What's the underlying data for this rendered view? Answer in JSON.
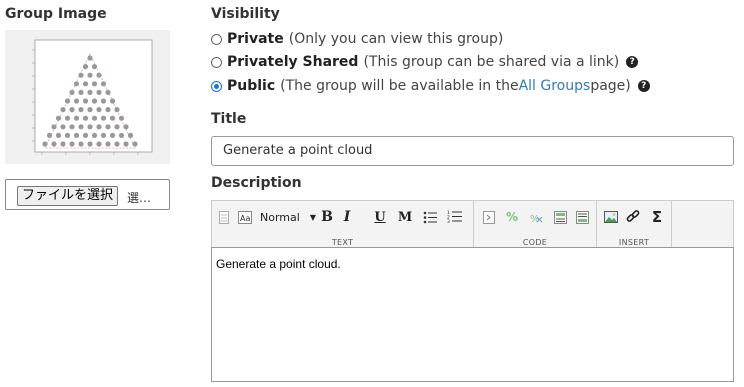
{
  "group_image": {
    "heading": "Group Image"
  },
  "file_input": {
    "button_label": "ファイルを選択",
    "file_name": "選…"
  },
  "visibility": {
    "heading": "Visibility",
    "options": [
      {
        "label": "Private",
        "description": "(Only you can view this group)",
        "checked": false
      },
      {
        "label": "Privately Shared",
        "description": "(This group can be shared via a link)",
        "checked": false,
        "help": "?"
      },
      {
        "label": "Public",
        "description_pre": "(The group will be available in the ",
        "link_text": "All Groups",
        "description_post": " page)",
        "checked": true,
        "help": "?"
      }
    ]
  },
  "title": {
    "heading": "Title",
    "value": "Generate a point cloud"
  },
  "description": {
    "heading": "Description",
    "toolbar": {
      "groups": [
        "TEXT",
        "CODE",
        "INSERT"
      ],
      "format_select": "Normal",
      "bold": "B",
      "italic": "I",
      "underline": "U",
      "mono": "M",
      "formula": "Σ"
    },
    "content": "Generate a point cloud."
  },
  "colors": {
    "link": "#337ab7",
    "radio_checked": "#1a73e8"
  }
}
